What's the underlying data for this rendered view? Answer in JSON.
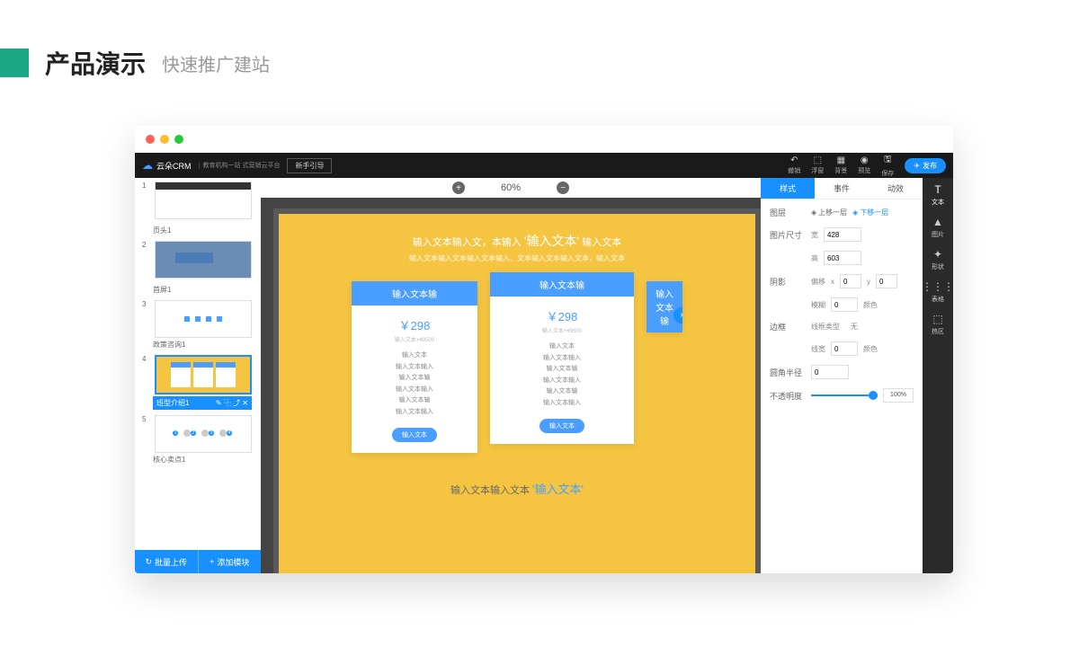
{
  "header": {
    "title": "产品演示",
    "subtitle": "快速推广建站"
  },
  "topbar": {
    "logo": "云朵CRM",
    "logo_sub": "教育机构一站\n式营销云平台",
    "guide": "新手引导",
    "tools": [
      {
        "icon": "↶",
        "label": "撤销"
      },
      {
        "icon": "⬚",
        "label": "浮窗"
      },
      {
        "icon": "▦",
        "label": "背景"
      },
      {
        "icon": "◉",
        "label": "预览"
      },
      {
        "icon": "🖫",
        "label": "保存"
      }
    ],
    "publish": "发布"
  },
  "zoom": {
    "minus": "−",
    "plus": "+",
    "value": "60%"
  },
  "slides": [
    {
      "num": "1",
      "label": "页头1"
    },
    {
      "num": "2",
      "label": "首屏1"
    },
    {
      "num": "3",
      "label": "政策咨询1"
    },
    {
      "num": "4",
      "label": "班型介绍1",
      "selected": true
    },
    {
      "num": "5",
      "label": "核心卖点1"
    }
  ],
  "sidebar_footer": {
    "upload": "批量上传",
    "add": "添加模块"
  },
  "canvas": {
    "title_pre": "输入文本输入文，本输入",
    "title_em": "'输入文本'",
    "title_post": "输入文本",
    "subtitle": "输入文本输入文本输入文本输入、文本输入文本输入文本，输入文本",
    "card_header": "输入文本输",
    "price": "￥298",
    "price_sub": "输入文本+¥9500",
    "features": [
      "输入文本",
      "输入文本输入",
      "输入文本输",
      "输入文本输入",
      "输入文本输",
      "输入文本输入"
    ],
    "card_btn": "输入文本",
    "footer_pre": "输入文本输入文本",
    "footer_em": "'输入文本'"
  },
  "props": {
    "tabs": [
      "样式",
      "事件",
      "动效"
    ],
    "layer_label": "图层",
    "layer_up": "上移一层",
    "layer_down": "下移一层",
    "size_label": "图片尺寸",
    "w_label": "宽",
    "w": "428",
    "h_label": "高",
    "h": "603",
    "shadow_label": "阴影",
    "offset_label": "偏移",
    "x_label": "x",
    "x": "0",
    "y_label": "y",
    "y": "0",
    "blur_label": "模糊",
    "blur": "0",
    "color_label": "颜色",
    "border_label": "边框",
    "line_type_label": "线框类型",
    "line_type": "无",
    "line_width_label": "线宽",
    "line_width": "0",
    "radius_label": "圆角半径",
    "radius": "0",
    "opacity_label": "不透明度",
    "opacity": "100%"
  },
  "toolstrip": [
    {
      "icon": "T",
      "label": "文本"
    },
    {
      "icon": "▲",
      "label": "图片"
    },
    {
      "icon": "✦",
      "label": "形状"
    },
    {
      "icon": "⋮⋮⋮",
      "label": "表格"
    },
    {
      "icon": "⬚",
      "label": "热区"
    }
  ]
}
